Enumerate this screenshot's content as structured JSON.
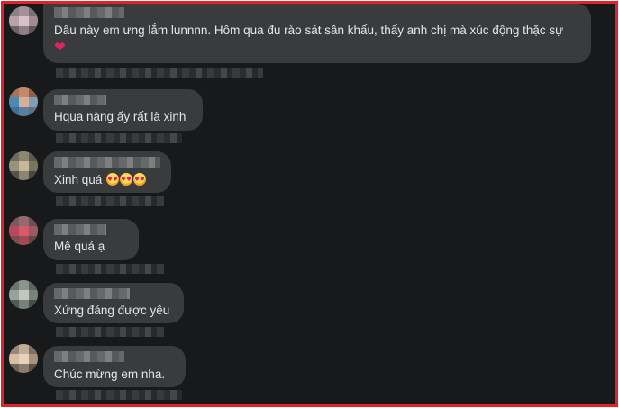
{
  "comments": [
    {
      "text": "Dâu này em ưng lắm lunnnn. Hôm qua đu rào sát sân khấu, thấy anh chị mà xúc động thặc sự",
      "emoji_after": "❤️"
    },
    {
      "text": "Hqua nàng ấy rất là xinh"
    },
    {
      "text": "Xinh quá",
      "emoji_after": "🥰🥰🥰"
    },
    {
      "text": "Mê quá ạ"
    },
    {
      "text": "Xứng đáng được yêu"
    },
    {
      "text": "Chúc mừng em nha."
    }
  ],
  "colors": {
    "background": "#18191a",
    "bubble": "#3a3b3c",
    "text": "#e4e6eb",
    "frame_border": "#e3212b",
    "heart": "#e0245e"
  },
  "icons": {
    "heart": "red-heart-icon",
    "smiling_face_with_hearts": "smiling-face-with-hearts-icon"
  }
}
